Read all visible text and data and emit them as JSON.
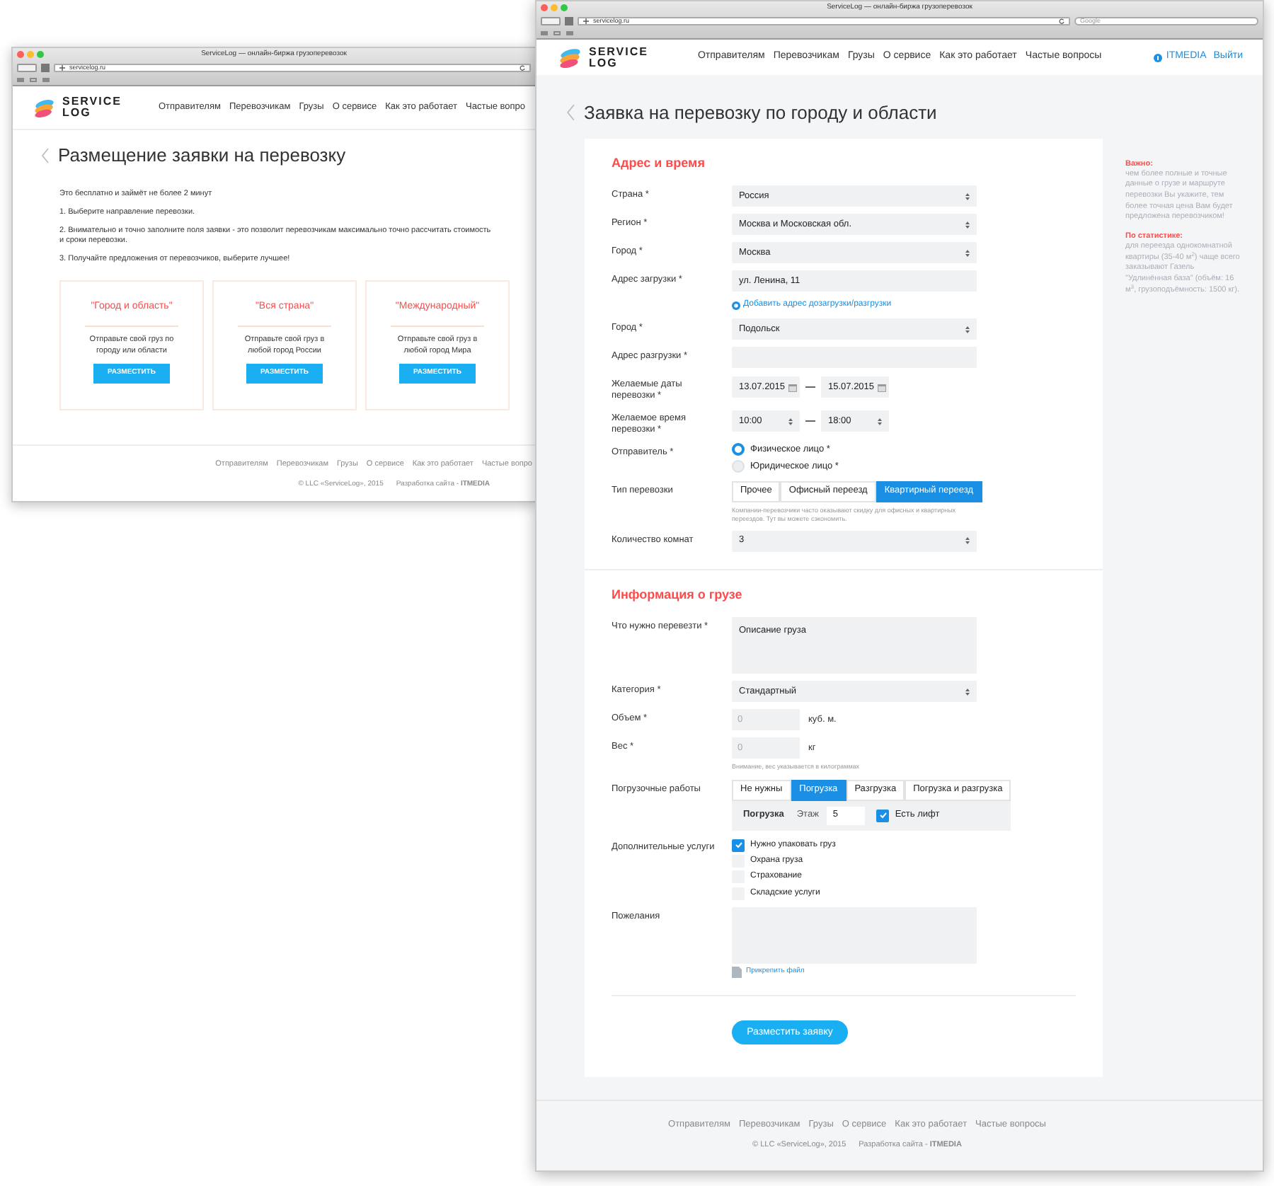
{
  "back_window": {
    "title": "ServiceLog — онлайн-биржа грузоперевозок",
    "url": "servicelog.ru",
    "logo": {
      "line1": "SERVICE",
      "line2": "LOG"
    },
    "nav": [
      "Отправителям",
      "Перевозчикам",
      "Грузы",
      "О сервисе",
      "Как это работает",
      "Частые вопро"
    ],
    "heading": "Размещение заявки на перевозку",
    "intro": "Это бесплатно и займёт не более 2 минут",
    "steps": [
      "1. Выберите направление перевозки.",
      "2. Внимательно и точно заполните поля заявки - это позволит перевозчикам максимально точно рассчитать стоимость и сроки перевозки.",
      "3. Получайте предложения от перевозчиков, выберите лучшее!"
    ],
    "cards": [
      {
        "title": "\"Город и область\"",
        "text": "Отправьте свой груз по городу или области",
        "button": "РАЗМЕСТИТЬ"
      },
      {
        "title": "\"Вся страна\"",
        "text": "Отправьте свой груз в любой город России",
        "button": "РАЗМЕСТИТЬ"
      },
      {
        "title": "\"Международный\"",
        "text": "Отправьте свой груз в любой город Мира",
        "button": "РАЗМЕСТИТЬ"
      }
    ],
    "footer": {
      "links": [
        "Отправителям",
        "Перевозчикам",
        "Грузы",
        "О сервисе",
        "Как это работает",
        "Частые вопро"
      ],
      "copyright": "© LLC «ServiceLog», 2015",
      "developer": "Разработка сайта - **ITMEDIA**"
    }
  },
  "front_window": {
    "title": "ServiceLog — онлайн-биржа грузоперевозок",
    "url": "servicelog.ru",
    "search": {
      "placeholder": "Google"
    },
    "logo": {
      "line1": "SERVICE",
      "line2": "LOG"
    },
    "nav": [
      "Отправителям",
      "Перевозчикам",
      "Грузы",
      "О сервисе",
      "Как это работает",
      "Частые вопросы"
    ],
    "user": {
      "name": "ITMEDIA",
      "logout": "Выйти"
    },
    "heading": "Заявка на перевозку по городу и области",
    "sections": [
      {
        "title": "Адрес и время",
        "fields": [
          {
            "kind": "select",
            "label": "Страна *",
            "value": "Россия"
          },
          {
            "kind": "select",
            "label": "Регион *",
            "value": "Москва и Московская обл."
          },
          {
            "kind": "select",
            "label": "Город *",
            "value": "Москва"
          },
          {
            "kind": "input",
            "label": "Адрес загрузки *",
            "value": "ул. Ленина, 11"
          },
          {
            "kind": "link",
            "text": "Добавить адрес дозагрузки/разгрузки"
          },
          {
            "kind": "select",
            "label": "Город *",
            "value": "Подольск"
          },
          {
            "kind": "input",
            "label": "Адрес разгрузки *"
          },
          {
            "kind": "dates",
            "label": "Желаемые даты перевозки *",
            "from": "13.07.2015",
            "to": "15.07.2015"
          },
          {
            "kind": "times",
            "label": "Желаемое время перевозки *",
            "from": "10:00",
            "to": "18:00"
          },
          {
            "kind": "radio",
            "label": "Отправитель *",
            "options": [
              {
                "label": "Физическое лицо *",
                "selected": true
              },
              {
                "label": "Юридическое лицо *",
                "selected": false
              }
            ]
          },
          {
            "kind": "segmented",
            "label": "Тип перевозки",
            "options": [
              {
                "label": "Прочее",
                "selected": false
              },
              {
                "label": "Офисный переезд",
                "selected": false
              },
              {
                "label": "Квартирный переезд",
                "selected": true
              }
            ],
            "hint": "Компании-перевозчики часто оказывают скидку для офисных и квартирных переездов. Тут вы можете сэкономить."
          },
          {
            "kind": "select",
            "label": "Количество комнат",
            "value": "3"
          }
        ]
      },
      {
        "title": "Информация о грузе",
        "fields": [
          {
            "kind": "textarea",
            "label": "Что нужно перевезти *",
            "value": "Описание груза"
          },
          {
            "kind": "select",
            "label": "Категория *",
            "value": "Стандартный"
          },
          {
            "kind": "unit",
            "label": "Объем *",
            "placeholder": "0",
            "unit": "куб. м."
          },
          {
            "kind": "unit",
            "label": "Вес *",
            "placeholder": "0",
            "unit": "кг",
            "hint": "Внимание, вес указывается в килограммах"
          },
          {
            "kind": "loading",
            "label": "Погрузочные работы",
            "options": [
              {
                "label": "Не нужны",
                "selected": false
              },
              {
                "label": "Погрузка",
                "selected": true
              },
              {
                "label": "Разгрузка",
                "selected": false
              },
              {
                "label": "Погрузка и разгрузка",
                "selected": false
              }
            ],
            "sub": {
              "title": "Погрузка",
              "floor_label": "Этаж",
              "floor": "5",
              "lift": {
                "label": "Есть лифт",
                "checked": true
              }
            }
          },
          {
            "kind": "checkboxes",
            "label": "Дополнительные услуги",
            "options": [
              {
                "label": "Нужно упаковать груз",
                "checked": true
              },
              {
                "label": "Охрана груза",
                "checked": false
              },
              {
                "label": "Страхование",
                "checked": false
              },
              {
                "label": "Складские услуги",
                "checked": false
              }
            ]
          },
          {
            "kind": "textarea",
            "label": "Пожелания"
          },
          {
            "kind": "attach",
            "text": "Прикрепить файл"
          }
        ]
      }
    ],
    "submit": "Разместить заявку",
    "aside": [
      {
        "title": "Важно:",
        "text": "чем более полные и точные данные о грузе и маршруте перевозки Вы укажите, тем более точная цена Вам будет предложена перевозчиком!"
      },
      {
        "title": "По статистике:",
        "text": "для переезда однокомнатной квартиры (35-40 м$^{2}$) чаще всего заказывают Газель \"Удлинённая база\" (объём: 16 м$^{3}$, грузоподъёмность: 1500 кг)."
      }
    ],
    "footer": {
      "links": [
        "Отправителям",
        "Перевозчикам",
        "Грузы",
        "О сервисе",
        "Как это работает",
        "Частые вопросы"
      ],
      "copyright": "© LLC «ServiceLog», 2015",
      "developer": "Разработка сайта - **ITMEDIA**"
    }
  }
}
